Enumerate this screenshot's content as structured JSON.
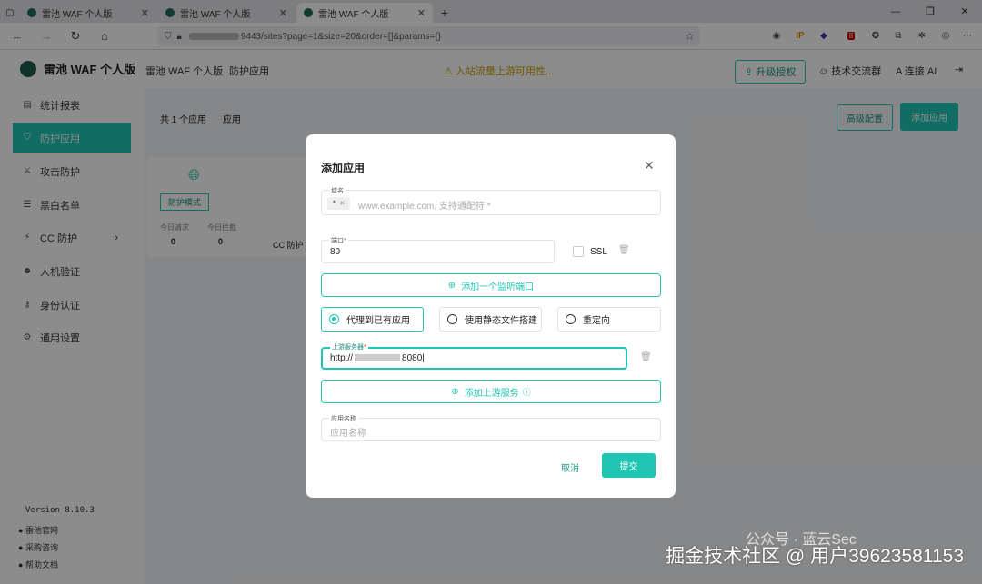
{
  "browser": {
    "tabs": [
      {
        "label": "雷池 WAF 个人版",
        "active": false
      },
      {
        "label": "雷池 WAF 个人版",
        "active": false
      },
      {
        "label": "雷池 WAF 个人版",
        "active": true
      }
    ],
    "new_tab": "+",
    "url_suffix": "9443/sites?page=1&size=20&order=[]&params={}",
    "ext_badge": "8",
    "ext_ip": "IP"
  },
  "app": {
    "logo": "雷池 WAF 个人版",
    "breadcrumb": [
      "雷池 WAF 个人版",
      "防护应用"
    ],
    "notice": "⚠ 入站流量上游可用性...",
    "upgrade": "升级授权",
    "community": "技术交流群",
    "ai": "连接 AI",
    "sidebar": [
      {
        "label": "统计报表",
        "icon": "chart-icon"
      },
      {
        "label": "防护应用",
        "icon": "shield-icon",
        "active": true
      },
      {
        "label": "攻击防护",
        "icon": "attack-icon"
      },
      {
        "label": "黑白名单",
        "icon": "list-icon"
      },
      {
        "label": "CC 防护",
        "icon": "cc-icon"
      },
      {
        "label": "人机验证",
        "icon": "user-check-icon"
      },
      {
        "label": "身份认证",
        "icon": "key-icon"
      },
      {
        "label": "通用设置",
        "icon": "gear-icon"
      }
    ],
    "version": "Version 8.10.3",
    "footer_links": [
      "雷池官网",
      "采购咨询",
      "帮助文档"
    ],
    "content_header": {
      "count": "共 1 个应用",
      "tab": "应用",
      "sec_btn": "高级配置",
      "add_btn": "添加应用"
    },
    "card": {
      "badge": "防护模式",
      "stat1_label": "今日请求",
      "stat1": "0",
      "stat2_label": "今日拦截",
      "stat2": "0",
      "cc": "CC 防护"
    }
  },
  "modal": {
    "title": "添加应用",
    "domain_label": "域名",
    "domain_chip": "*",
    "domain_placeholder": "www.example.com, 支持通配符 *",
    "port_label": "端口",
    "port_value": "80",
    "ssl_label": "SSL",
    "add_port": "添加一个监听端口",
    "modes": [
      "代理到已有应用",
      "使用静态文件搭建",
      "重定向"
    ],
    "upstream_label": "上游服务器",
    "upstream_value": "http://",
    "upstream_port": "8080",
    "add_upstream": "添加上游服务",
    "name_label": "应用名称",
    "name_placeholder": "应用名称",
    "cancel": "取消",
    "submit": "提交"
  },
  "watermark": "掘金技术社区 @ 用户3962358115​3",
  "watermark2": "公众号 · 蓝云Sec"
}
